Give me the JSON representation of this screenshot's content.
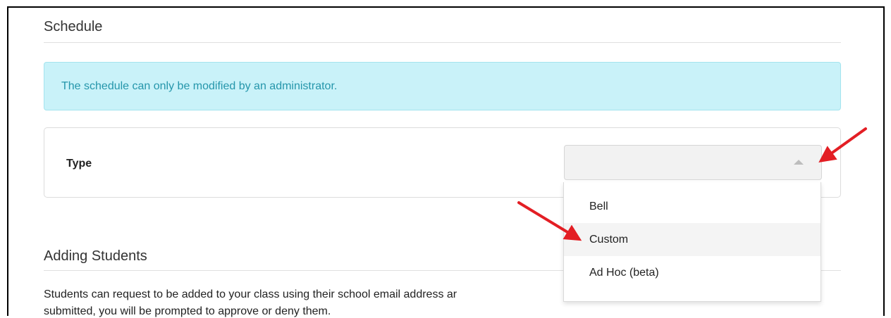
{
  "schedule": {
    "title": "Schedule",
    "alert_text": "The schedule can only be modified by an administrator.",
    "type_label": "Type",
    "type_value": "",
    "options": [
      "Bell",
      "Custom",
      "Ad Hoc (beta)"
    ],
    "hovered_option": "Custom"
  },
  "adding_students": {
    "title": "Adding Students",
    "text": "Students can request to be added to your class using their school email address ar",
    "text_line2": "submitted, you will be prompted to approve or deny them."
  },
  "colors": {
    "alert_bg": "#c9f2f9",
    "alert_text": "#2596ab",
    "annotation_arrow": "#e31e24"
  },
  "icons": {
    "select_caret": "caret-up-icon",
    "annotation": "red-arrow-icon"
  }
}
